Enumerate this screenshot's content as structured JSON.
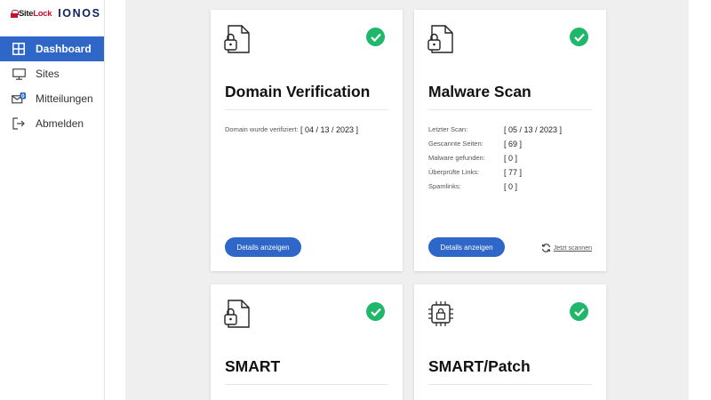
{
  "brand": {
    "sitelock_pre": "Site",
    "sitelock_post": "Lock",
    "ionos": "IONOS"
  },
  "sidebar": {
    "items": [
      {
        "label": "Dashboard",
        "icon": "dashboard-grid-icon",
        "active": true
      },
      {
        "label": "Sites",
        "icon": "monitor-icon"
      },
      {
        "label": "Mitteilungen",
        "icon": "mail-icon",
        "badge": "0"
      },
      {
        "label": "Abmelden",
        "icon": "logout-icon"
      }
    ]
  },
  "cards": [
    {
      "title": "Domain Verification",
      "icon": "document-lock-icon",
      "status": "verified",
      "details": [
        {
          "k": "Domain wurde verifiziert:",
          "v": "[ 04 / 13 / 2023 ]"
        }
      ],
      "button": "Details anzeigen"
    },
    {
      "title": "Malware Scan",
      "icon": "document-lock-icon",
      "status": "verified",
      "details": [
        {
          "k": "Letzter Scan:",
          "v": "[ 05 / 13 / 2023 ]"
        },
        {
          "k": "Gescannte Seiten:",
          "v": "[ 69 ]"
        },
        {
          "k": "Malware gefunden:",
          "v": "[ 0 ]"
        },
        {
          "k": "Überprüfte Links:",
          "v": "[ 77 ]"
        },
        {
          "k": "Spamlinks:",
          "v": "[ 0 ]"
        }
      ],
      "button": "Details anzeigen",
      "rescan": "Jetzt scannen"
    },
    {
      "title": "SMART",
      "icon": "document-lock-icon",
      "status": "verified"
    },
    {
      "title": "SMART/Patch",
      "icon": "chip-lock-icon",
      "status": "verified"
    }
  ],
  "colors": {
    "accent": "#2f67c9",
    "success": "#1fb86b",
    "background": "#efefef"
  }
}
